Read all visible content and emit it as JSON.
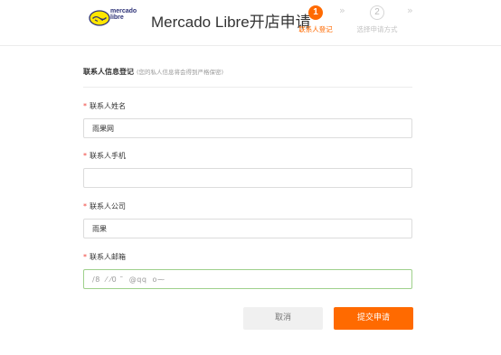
{
  "header": {
    "logo_text_line1": "mercado",
    "logo_text_line2": "libre",
    "title": "Mercado Libre开店申请",
    "steps": [
      {
        "num": "1",
        "label": "联系人登记",
        "state": "active"
      },
      {
        "num": "2",
        "label": "选择申请方式",
        "state": "inactive"
      }
    ],
    "chevron": "»"
  },
  "section": {
    "title": "联系人信息登记",
    "note": "(您的私人信息将会得到严格保密)"
  },
  "form": {
    "required_mark": "*",
    "fields": [
      {
        "label": "联系人姓名",
        "value": "雨果网",
        "placeholder": ""
      },
      {
        "label": "联系人手机",
        "value": "",
        "placeholder": ""
      },
      {
        "label": "联系人公司",
        "value": "雨果",
        "placeholder": ""
      },
      {
        "label": "联系人邮箱",
        "value": "/8  ⁄ ⁄0 ˜  @qq  o⁓",
        "placeholder": ""
      }
    ]
  },
  "buttons": {
    "cancel": "取消",
    "submit": "提交申请"
  },
  "colors": {
    "accent": "#ff6a00",
    "required": "#f0413a",
    "focus_border": "#9ed08b",
    "brand_yellow": "#ffe600",
    "brand_navy": "#2d3277"
  }
}
